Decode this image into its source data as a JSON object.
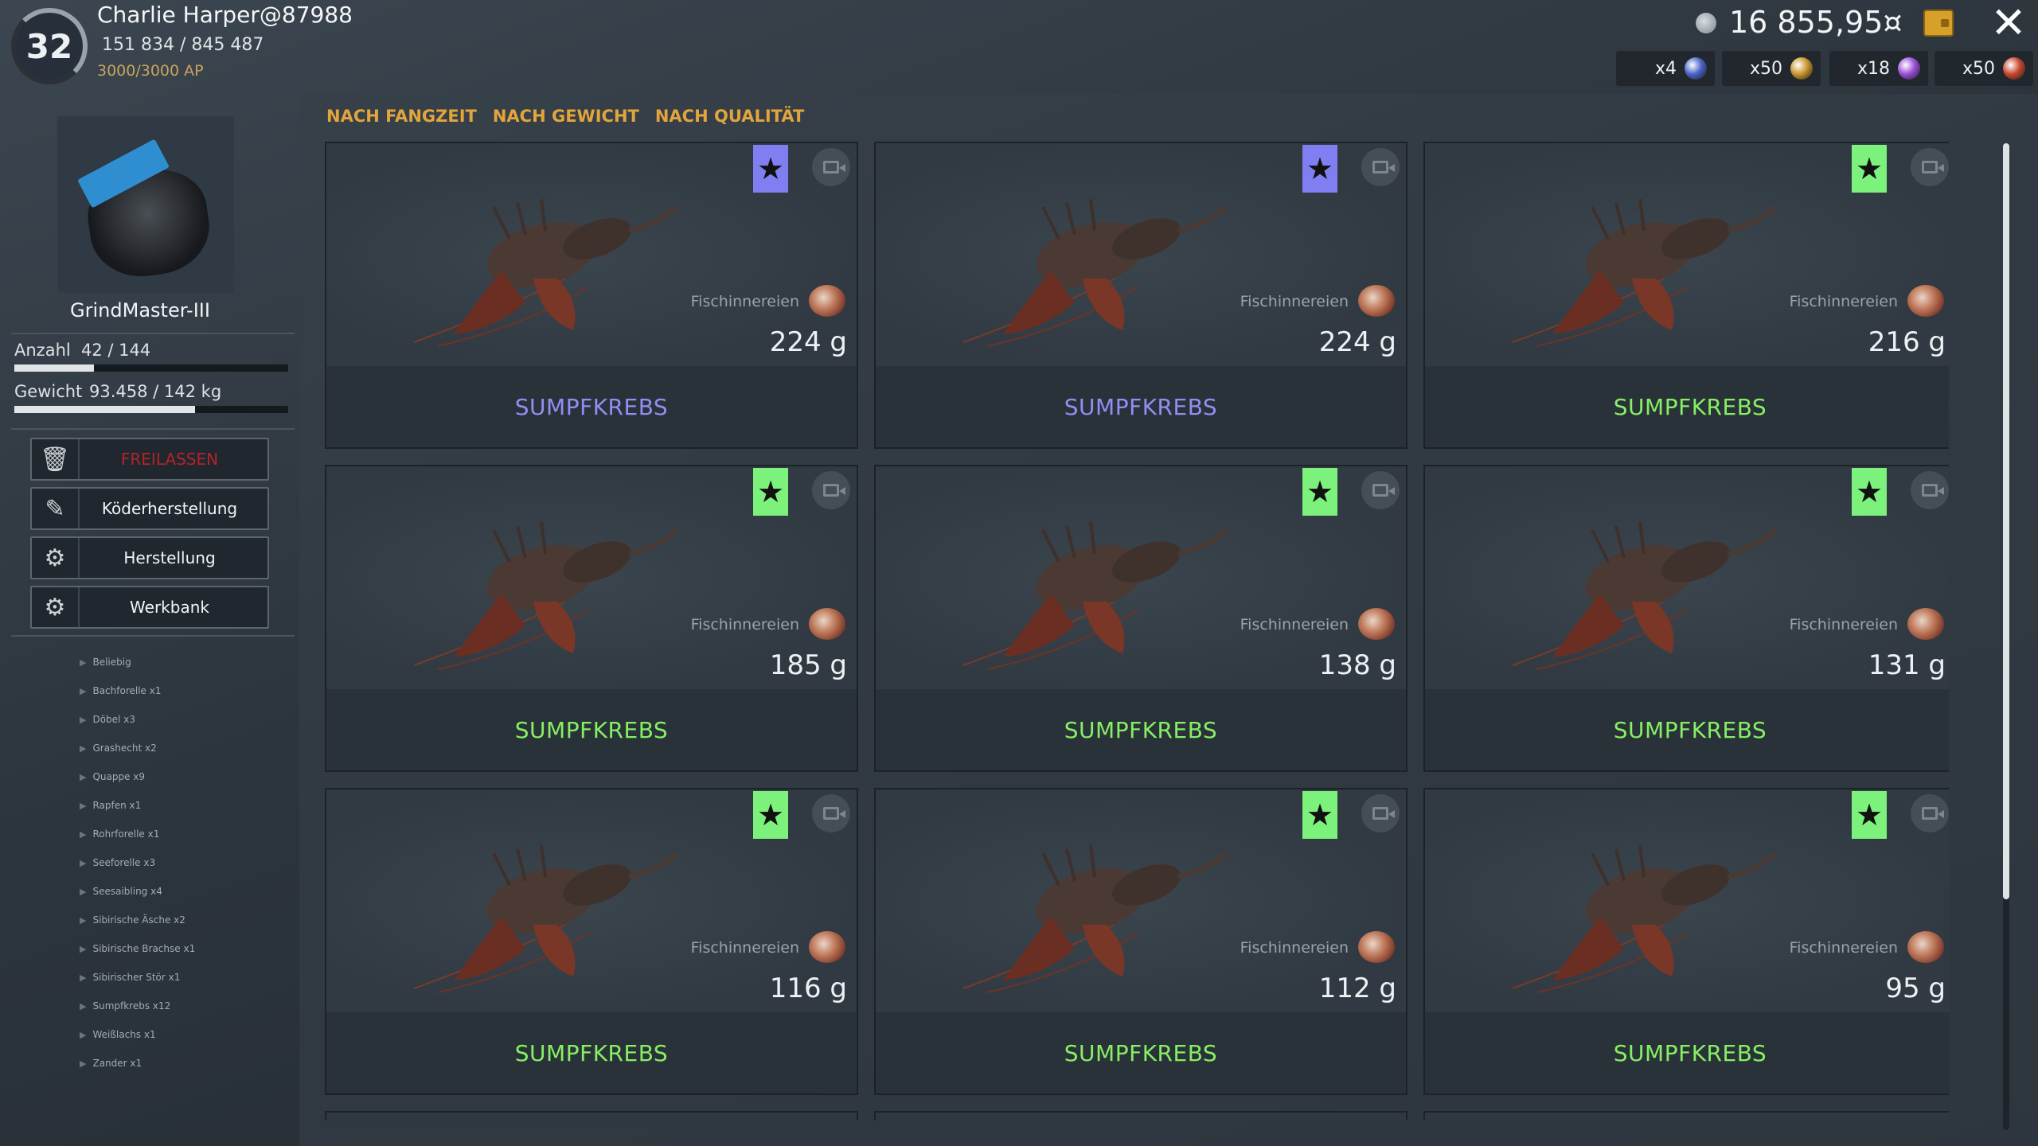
{
  "header": {
    "level": "32",
    "player_name": "Charlie Harper@87988",
    "xp_text": "151 834 /  845 487",
    "ap_text": "3000/3000 AP",
    "currency_value": "16 855,95¤",
    "baits": [
      {
        "count": "x4",
        "color": "#4a63c8"
      },
      {
        "count": "x50",
        "color": "#c9962b"
      },
      {
        "count": "x18",
        "color": "#9a4ed6"
      },
      {
        "count": "x50",
        "color": "#c8462e"
      }
    ]
  },
  "sidebar": {
    "item_name": "GrindMaster-III",
    "count_label": "Anzahl",
    "count_value": "42 / 144",
    "count_fraction": 0.29,
    "weight_label": "Gewicht",
    "weight_value": "93.458 / 142 kg",
    "weight_fraction": 0.66,
    "buttons": [
      {
        "label": "FREILASSEN",
        "icon": "trash-icon"
      },
      {
        "label": "Köderherstellung",
        "icon": "lure-icon"
      },
      {
        "label": "Herstellung",
        "icon": "gear-icon"
      },
      {
        "label": "Werkbank",
        "icon": "workbench-icon"
      }
    ],
    "species": [
      "Beliebig",
      "Bachforelle x1",
      "Döbel x3",
      "Grashecht x2",
      "Quappe x9",
      "Rapfen x1",
      "Rohrforelle x1",
      "Seeforelle x3",
      "Seesaibling x4",
      "Sibirische Äsche x2",
      "Sibirische Brachse x1",
      "Sibirischer Stör x1",
      "Sumpfkrebs x12",
      "Weißlachs x1",
      "Zander x1"
    ]
  },
  "sort": {
    "by_time": "NACH FANGZEIT",
    "by_weight": "NACH GEWICHT",
    "by_quality": "NACH QUALITÄT"
  },
  "colors": {
    "quality_purple": "#7f7ff2",
    "quality_green": "#7cf27c",
    "name_purple": "#8f8ff5",
    "name_green": "#86ef63"
  },
  "cards": [
    {
      "name": "SUMPFKREBS",
      "weight": "224 g",
      "bait": "Fischinnereien",
      "quality": "purple"
    },
    {
      "name": "SUMPFKREBS",
      "weight": "224 g",
      "bait": "Fischinnereien",
      "quality": "purple"
    },
    {
      "name": "SUMPFKREBS",
      "weight": "216 g",
      "bait": "Fischinnereien",
      "quality": "green"
    },
    {
      "name": "SUMPFKREBS",
      "weight": "185 g",
      "bait": "Fischinnereien",
      "quality": "green"
    },
    {
      "name": "SUMPFKREBS",
      "weight": "138 g",
      "bait": "Fischinnereien",
      "quality": "green"
    },
    {
      "name": "SUMPFKREBS",
      "weight": "131 g",
      "bait": "Fischinnereien",
      "quality": "green"
    },
    {
      "name": "SUMPFKREBS",
      "weight": "116 g",
      "bait": "Fischinnereien",
      "quality": "green"
    },
    {
      "name": "SUMPFKREBS",
      "weight": "112 g",
      "bait": "Fischinnereien",
      "quality": "green"
    },
    {
      "name": "SUMPFKREBS",
      "weight": "95 g",
      "bait": "Fischinnereien",
      "quality": "green"
    }
  ]
}
